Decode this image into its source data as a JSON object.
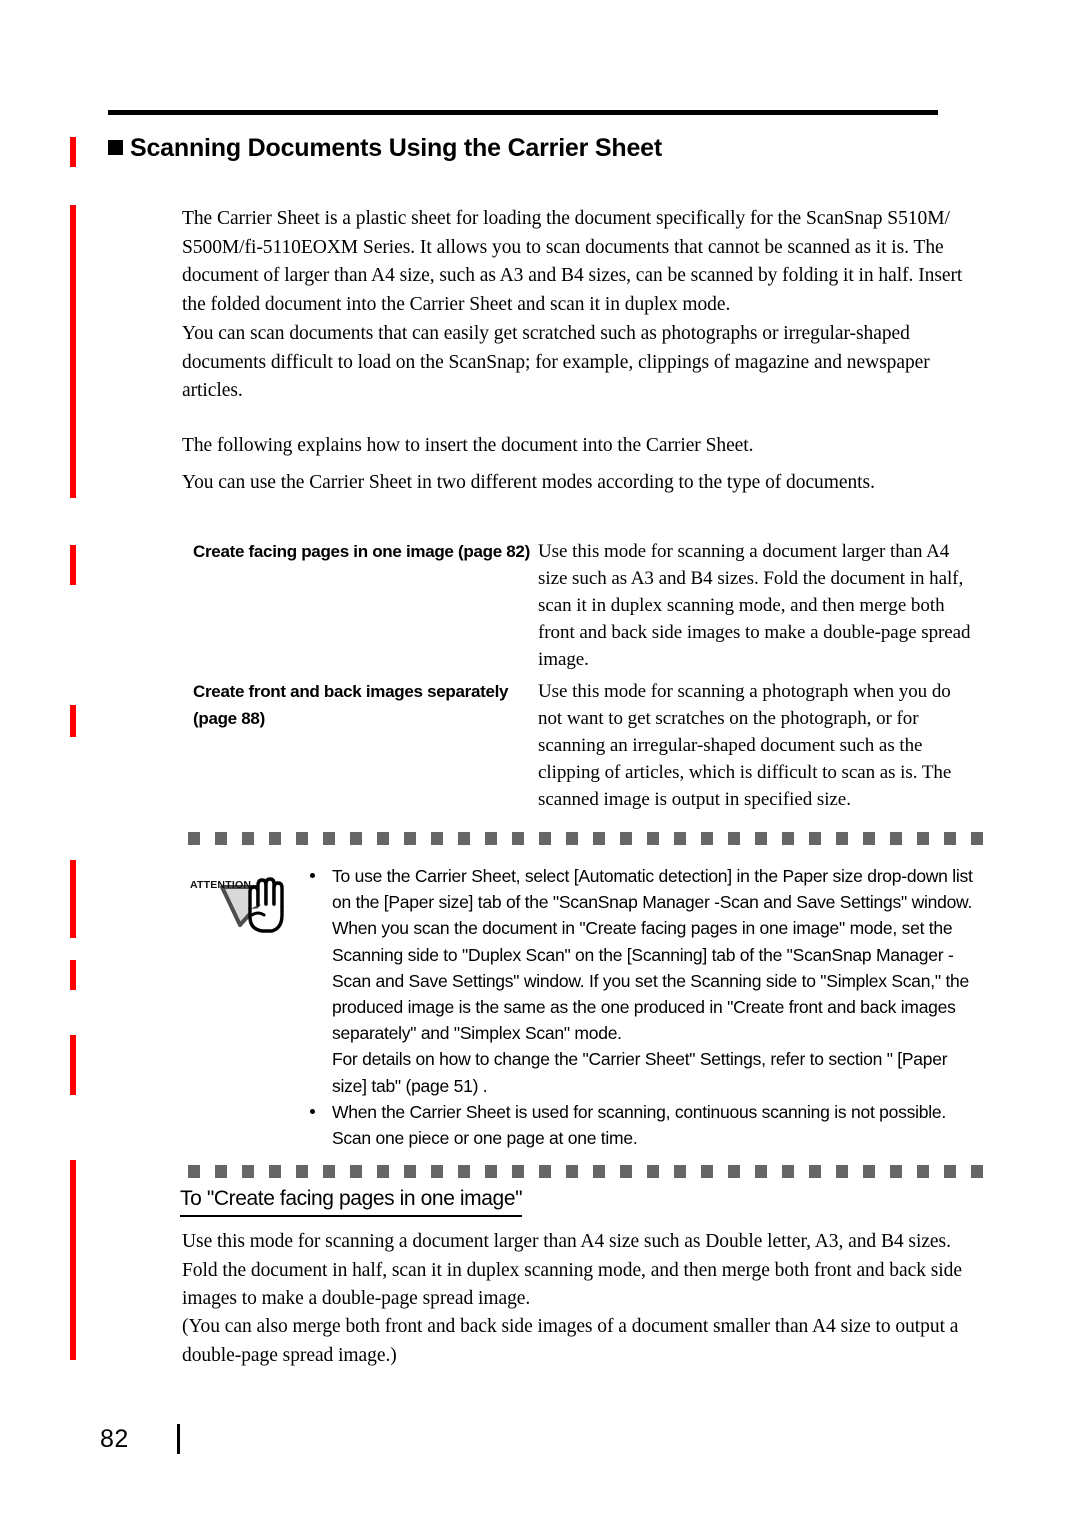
{
  "page": {
    "number": "82",
    "accent_color": "#ff0000",
    "rule_color": "#000000",
    "dash_color": "#666666"
  },
  "heading": {
    "bullet": "black-square",
    "text": "Scanning Documents Using the Carrier Sheet"
  },
  "intro": {
    "p1": "The Carrier Sheet is a plastic sheet for loading the document specifically for the ScanSnap S510M/ S500M/fi-5110EOXM Series. It allows you to scan documents that cannot be scanned as it is. The document of larger than A4 size, such as A3 and B4 sizes, can be scanned by folding it in half. Insert the folded document into the Carrier Sheet and scan it in duplex mode.",
    "p2": "You can scan documents that can easily get scratched such as photographs or irregular-shaped documents difficult to load on the ScanSnap; for example, clippings of magazine and newspaper articles.",
    "p3": "The following explains how to insert the document into the Carrier Sheet.",
    "p4": "You can use the Carrier Sheet in two different modes according to the type of documents."
  },
  "modes": [
    {
      "term": "Create facing pages in one image (page 82)",
      "definition": "Use this mode for scanning a document larger than A4 size such as A3 and B4 sizes. Fold the document in half, scan it in duplex scanning mode, and then merge both front and back side images to make a double-page spread image."
    },
    {
      "term": "Create front and back images separately (page 88)",
      "definition": "Use this mode for scanning a photograph when you do not want to get scratches on the photograph, or for scanning an irregular-shaped document such as the clipping of articles, which is difficult to scan as is. The scanned image is output in specified size."
    }
  ],
  "attention": {
    "icon_label": "ATTENTION",
    "items": [
      "To use the Carrier Sheet, select [Automatic detection] in the Paper size drop-down list on the [Paper size] tab of the \"ScanSnap Manager -Scan and Save Settings\" window. When you scan the document in \"Create facing pages in one image\" mode, set the Scanning side to \"Duplex Scan\" on the [Scanning] tab of the \"ScanSnap Manager -Scan and Save Settings\" window. If you set the Scanning side to \"Simplex Scan,\" the produced image is the same as the one produced in \"Create front and back images separately\" and \"Simplex Scan\" mode.",
      "When the Carrier Sheet is used for scanning, continuous scanning is not possible. Scan one piece or one page at one time."
    ],
    "item1_continuation": "For details on how to change the \"Carrier Sheet\" Settings, refer to section \" [Paper size] tab\" (page 51) ."
  },
  "subsection": {
    "heading": "To \"Create facing pages in one image\"",
    "p1": "Use this mode for scanning a document larger than A4 size such as Double letter, A3, and B4 sizes. Fold the document in half, scan it in duplex scanning mode, and then merge both front and back side images to make a double-page spread image.",
    "p2": "(You can also merge both front and back side images of a document smaller than A4 size to output a double-page spread image.)"
  }
}
